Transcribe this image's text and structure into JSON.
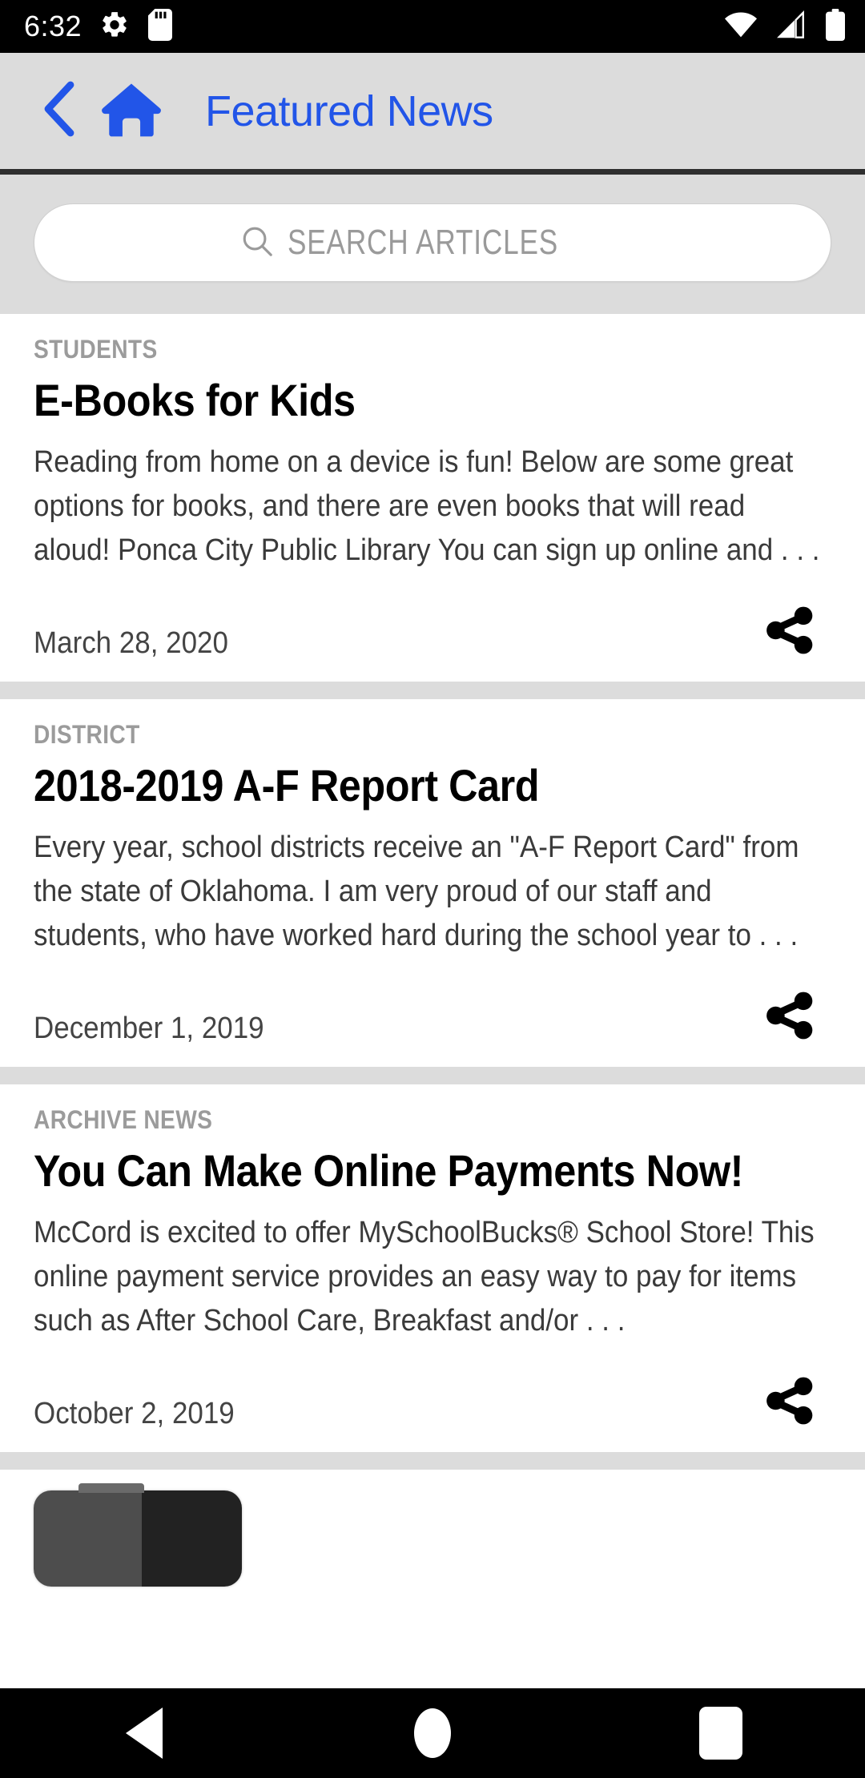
{
  "status_bar": {
    "time": "6:32",
    "left_icons": [
      "gear-icon",
      "sd-card-icon"
    ],
    "right_icons": [
      "wifi-icon",
      "cellular-signal-icon",
      "battery-icon"
    ],
    "background_color": "#000000",
    "foreground_color": "#ffffff"
  },
  "header": {
    "back_icon": "chevron-left-icon",
    "home_icon": "home-icon",
    "title": "Featured News",
    "accent_color": "#2255e8",
    "background_color": "#dcdcdc"
  },
  "search": {
    "placeholder": "SEARCH ARTICLES",
    "value": "",
    "icon": "search-icon"
  },
  "articles": [
    {
      "category": "STUDENTS",
      "title": "E-Books for Kids",
      "excerpt": "Reading from home on a device is fun!  Below are some great options for books, and there are even books that will read aloud! Ponca City Public Library You can sign up online and . . .",
      "date": "March 28, 2020",
      "share_icon": "share-icon"
    },
    {
      "category": "DISTRICT",
      "title": "2018-2019 A-F Report Card",
      "excerpt": "Every year, school districts receive an \"A-F Report Card\" from the state of Oklahoma. I am very proud of our staff and students, who have worked hard during the school year to . . .",
      "date": "December 1, 2019",
      "share_icon": "share-icon"
    },
    {
      "category": "ARCHIVE NEWS",
      "title": "You Can Make Online Payments Now!",
      "excerpt": "  McCord is excited to offer MySchoolBucks® School Store! This online payment service provides an easy way to pay for items such as After School Care, Breakfast and/or . . .",
      "date": "October 2, 2019",
      "share_icon": "share-icon"
    }
  ],
  "nav_bar": {
    "back_label": "Back",
    "home_label": "Home",
    "recents_label": "Recent apps"
  }
}
